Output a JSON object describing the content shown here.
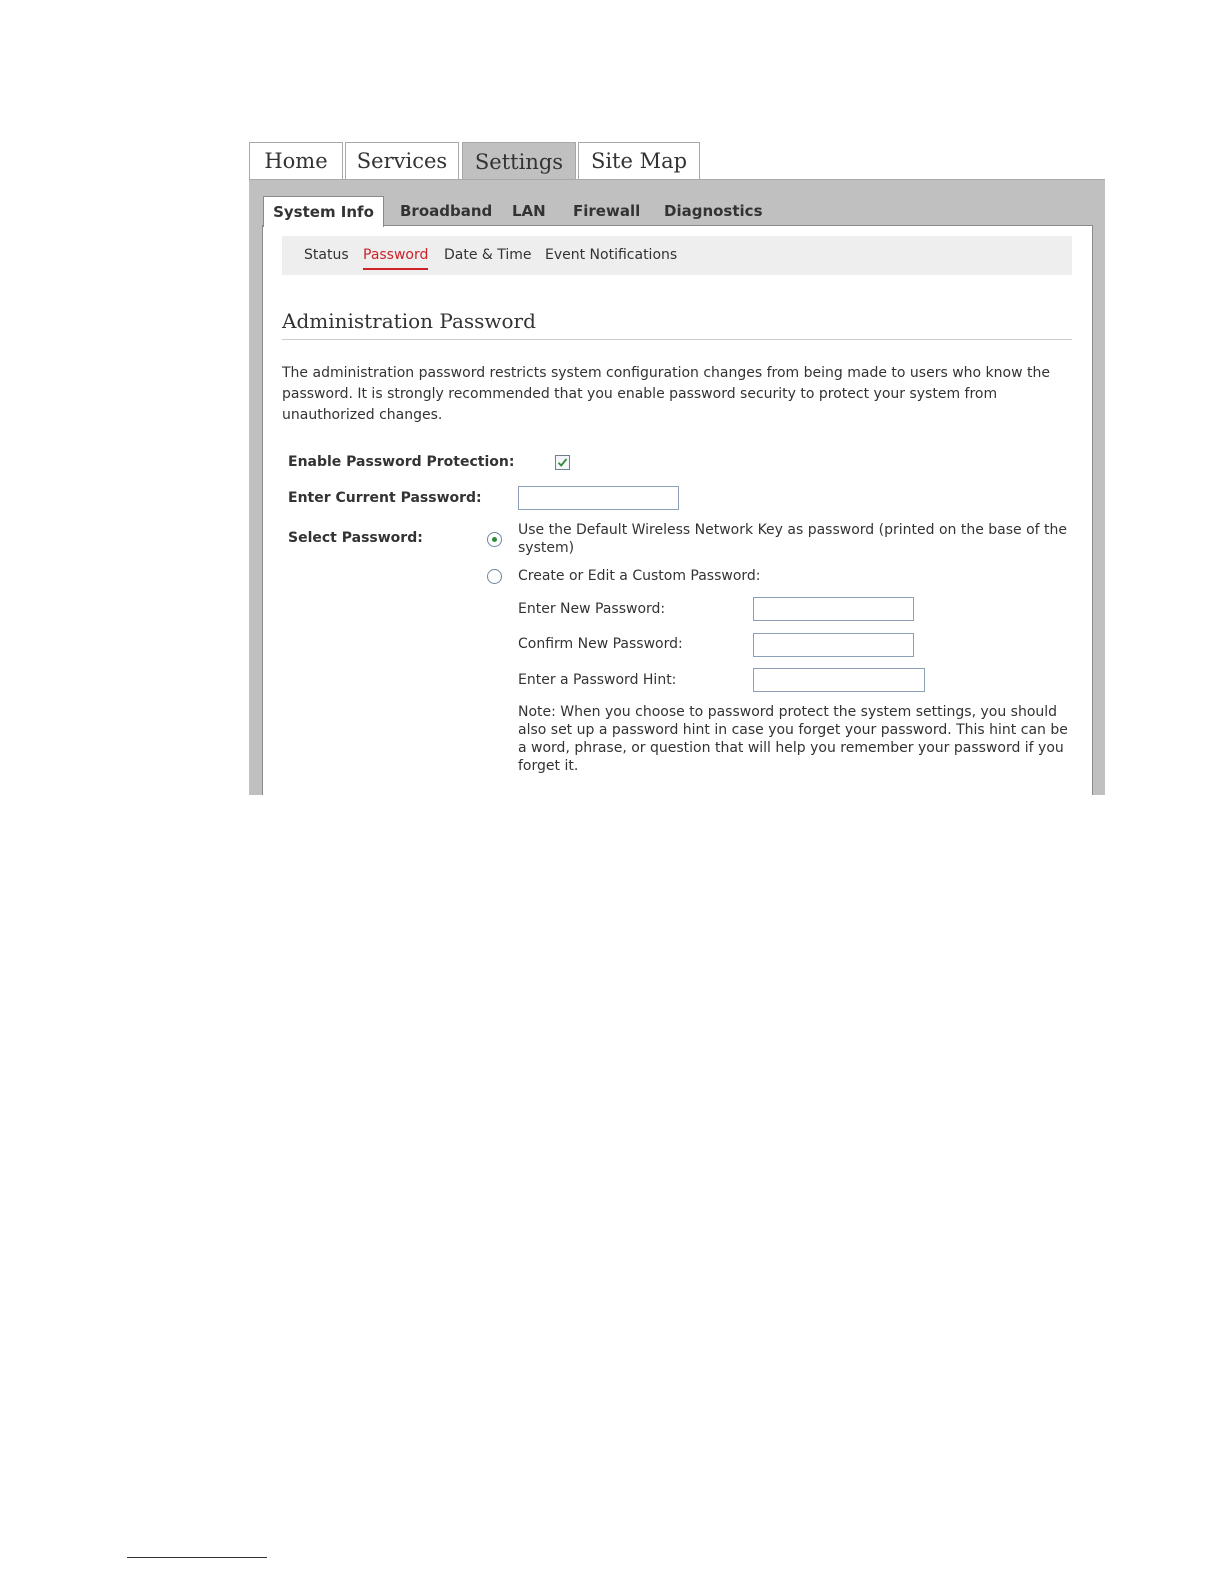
{
  "top_tabs": {
    "home": "Home",
    "services": "Services",
    "settings": "Settings",
    "site_map": "Site Map"
  },
  "sub_tabs": {
    "system_info": "System Info",
    "broadband": "Broadband",
    "lan": "LAN",
    "firewall": "Firewall",
    "diagnostics": "Diagnostics"
  },
  "subnav": {
    "status": "Status",
    "password": "Password",
    "date_time": "Date & Time",
    "event_notifications": "Event Notifications"
  },
  "main": {
    "title": "Administration Password",
    "intro": "The administration password restricts system configuration changes from being made to users who know the password. It is strongly recommended that you enable password security to protect your system from unauthorized changes.",
    "enable_label": "Enable Password Protection:",
    "enable_checked": true,
    "current_password_label": "Enter Current Password:",
    "current_password_value": "",
    "select_password_label": "Select Password:",
    "option_default": "Use the Default Wireless Network Key as password (printed on the base of the system)",
    "option_default_selected": true,
    "option_custom": "Create or Edit a Custom Password:",
    "new_password_label": "Enter New Password:",
    "new_password_value": "",
    "confirm_password_label": "Confirm New Password:",
    "confirm_password_value": "",
    "hint_label": "Enter a Password Hint:",
    "hint_value": "",
    "note": "Note: When you choose to password protect the system settings, you should also set up a password hint in case you forget your password. This hint can be a word, phrase, or question that will help you remember your password if you forget it."
  },
  "colors": {
    "accent_red": "#cc2229",
    "frame_grey": "#c0c0c0",
    "check_green": "#2f8c3a"
  }
}
